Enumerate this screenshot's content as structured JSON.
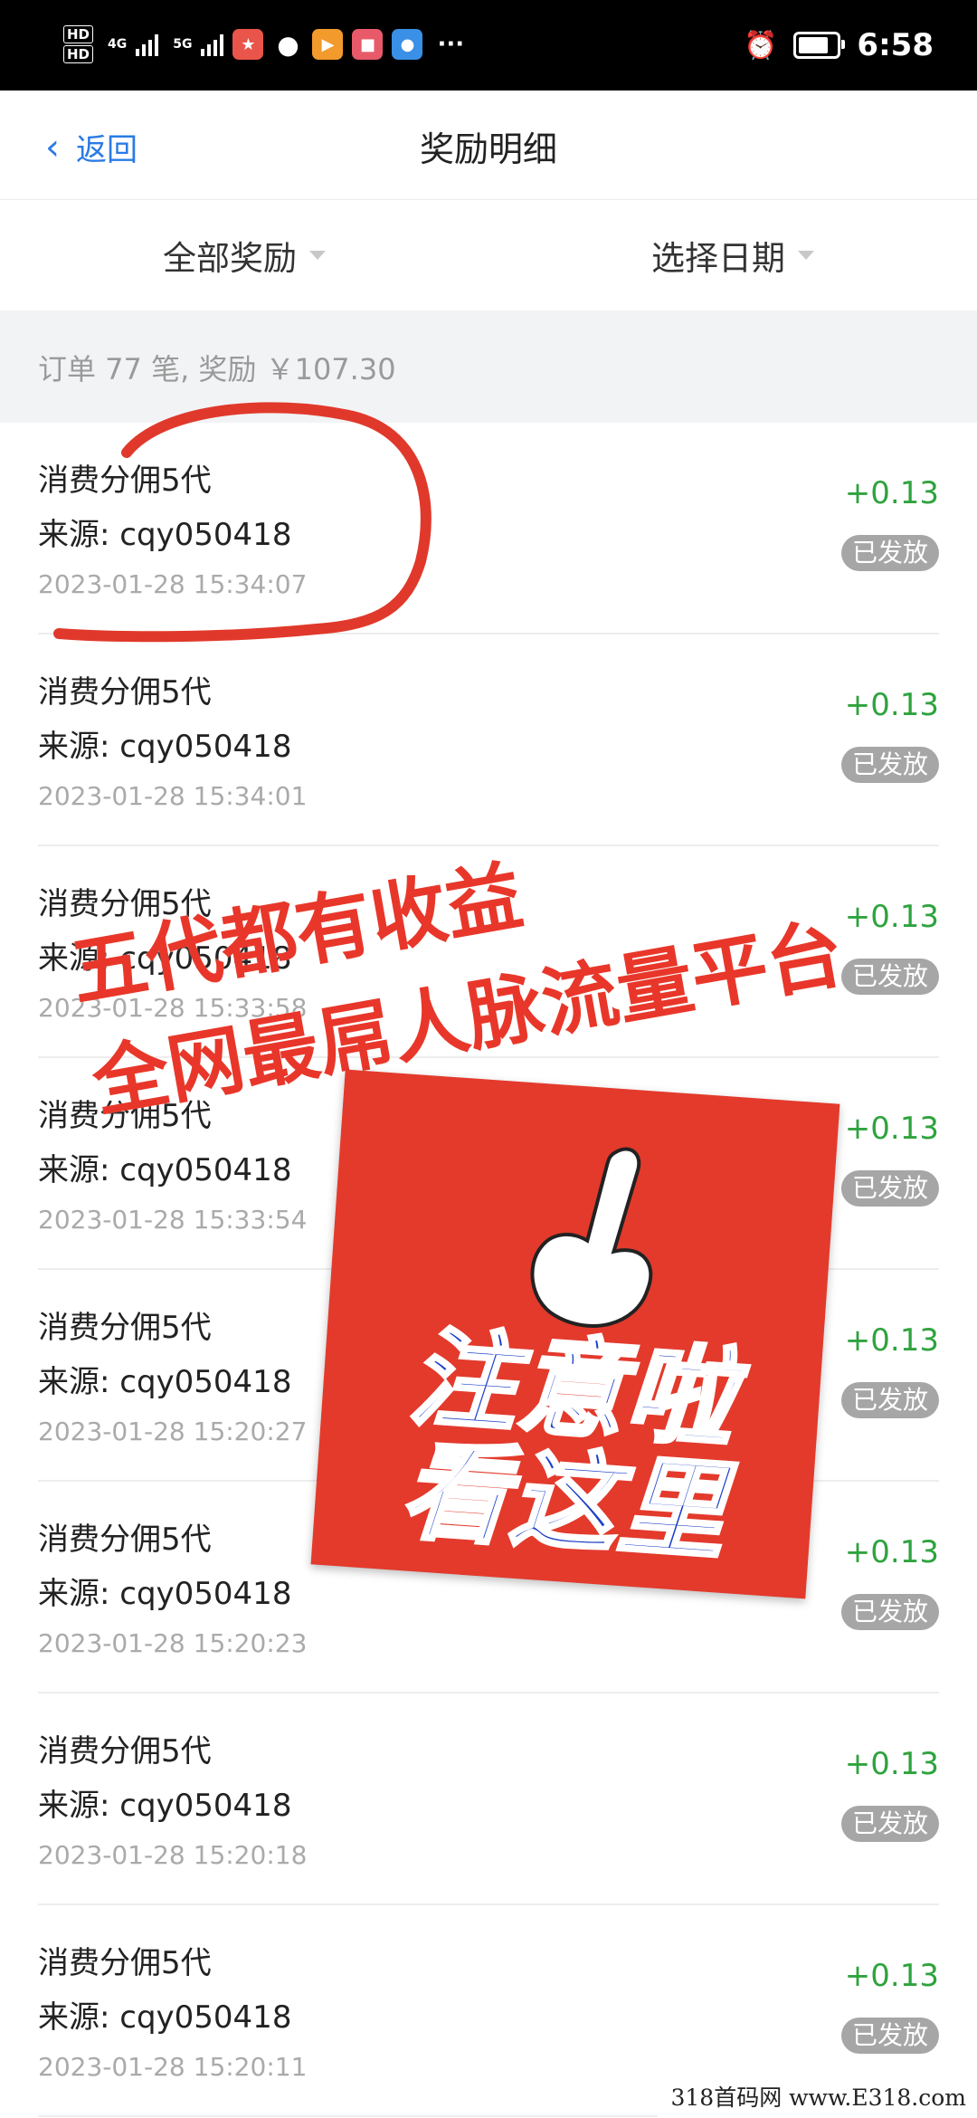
{
  "status_bar": {
    "time": "6:58",
    "hd1": "HD",
    "hd2": "HD",
    "net1": "4G",
    "net2": "5G",
    "more": "···",
    "alarm_icon": "alarm-clock-icon",
    "battery_icon": "battery-icon"
  },
  "header": {
    "back_label": "返回",
    "title": "奖励明细"
  },
  "filters": {
    "all_rewards": "全部奖励",
    "select_date": "选择日期"
  },
  "summary": "订单 77 笔, 奖励 ￥107.30",
  "records": [
    {
      "type": "消费分佣5代",
      "source": "来源: cqy050418",
      "time": "2023-01-28 15:34:07",
      "amount": "+0.13",
      "status": "已发放"
    },
    {
      "type": "消费分佣5代",
      "source": "来源: cqy050418",
      "time": "2023-01-28 15:34:01",
      "amount": "+0.13",
      "status": "已发放"
    },
    {
      "type": "消费分佣5代",
      "source": "来源: cqy050418",
      "time": "2023-01-28 15:33:58",
      "amount": "+0.13",
      "status": "已发放"
    },
    {
      "type": "消费分佣5代",
      "source": "来源: cqy050418",
      "time": "2023-01-28 15:33:54",
      "amount": "+0.13",
      "status": "已发放"
    },
    {
      "type": "消费分佣5代",
      "source": "来源: cqy050418",
      "time": "2023-01-28 15:20:27",
      "amount": "+0.13",
      "status": "已发放"
    },
    {
      "type": "消费分佣5代",
      "source": "来源: cqy050418",
      "time": "2023-01-28 15:20:23",
      "amount": "+0.13",
      "status": "已发放"
    },
    {
      "type": "消费分佣5代",
      "source": "来源: cqy050418",
      "time": "2023-01-28 15:20:18",
      "amount": "+0.13",
      "status": "已发放"
    },
    {
      "type": "消费分佣5代",
      "source": "来源: cqy050418",
      "time": "2023-01-28 15:20:11",
      "amount": "+0.13",
      "status": "已发放"
    }
  ],
  "overlay": {
    "line1": "五代都有收益",
    "line2": "全网最屌人脉流量平台",
    "poster_line1": "注意啦",
    "poster_line2": "看这里"
  },
  "watermark": "318首码网 www.E318.com",
  "colors": {
    "accent_blue": "#2b7be4",
    "amount_green": "#2fa33e",
    "badge_gray": "#a6a6a6",
    "overlay_red": "#e8372a",
    "poster_blue": "#1c3fc8"
  }
}
